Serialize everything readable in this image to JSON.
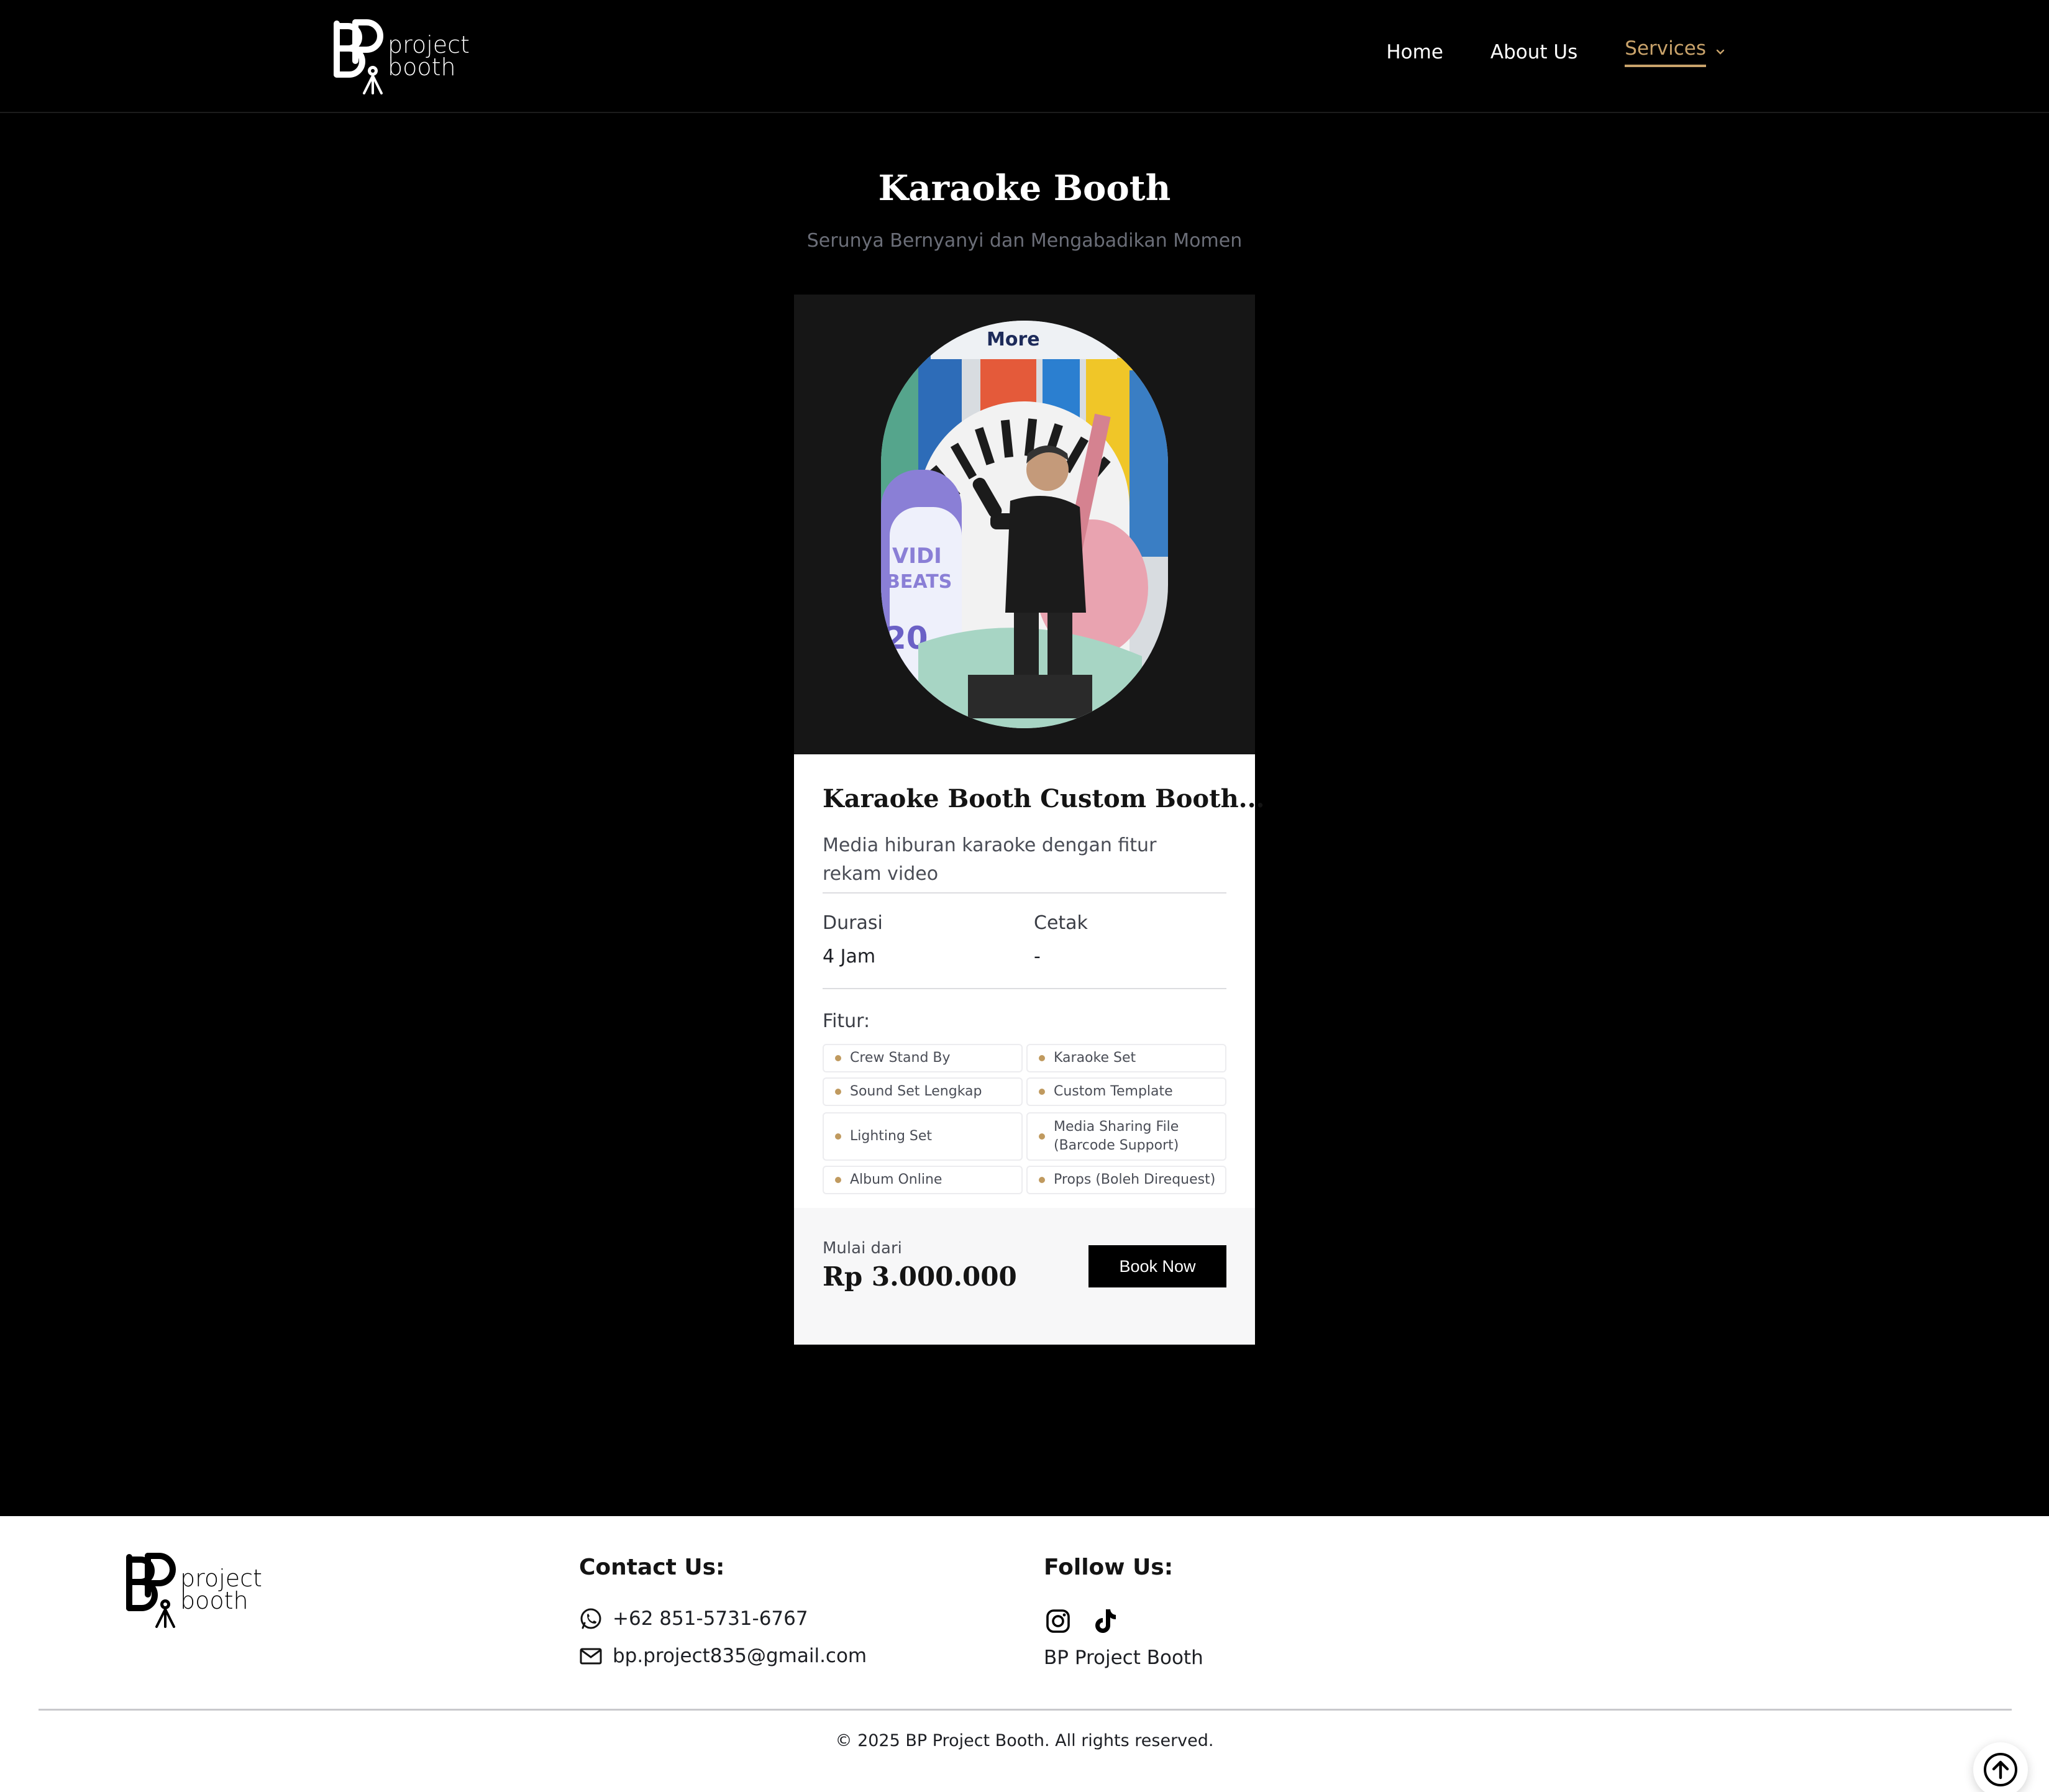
{
  "header": {
    "logo_line1": "project",
    "logo_line2": "booth",
    "nav": {
      "home": "Home",
      "about": "About Us",
      "services": "Services"
    }
  },
  "hero": {
    "title": "Karaoke Booth",
    "subtitle": "Serunya Bernyanyi dan Mengabadikan Momen"
  },
  "card": {
    "image_alt": "Karaoke singer performing at booth",
    "title": "Karaoke Booth Custom Booth...",
    "description": "Media hiburan karaoke dengan fitur rekam video",
    "duration_label": "Durasi",
    "duration_value": "4 Jam",
    "print_label": "Cetak",
    "print_value": "-",
    "features_label": "Fitur:",
    "features": [
      "Crew Stand By",
      "Karaoke Set",
      "Sound Set Lengkap",
      "Custom Template",
      "Lighting Set",
      "Media Sharing File (Barcode Support)",
      "Album Online",
      "Props (Boleh Direquest)"
    ],
    "price_label": "Mulai dari",
    "price": "Rp 3.000.000",
    "book_button": "Book Now"
  },
  "footer": {
    "logo_line1": "project",
    "logo_line2": "booth",
    "contact_heading": "Contact Us:",
    "phone": "+62 851-5731-6767",
    "email": "bp.project835@gmail.com",
    "follow_heading": "Follow Us:",
    "brand": "BP Project Booth",
    "copyright": "© 2025 BP Project Booth. All rights reserved."
  },
  "colors": {
    "accent": "#c9a36b",
    "background": "#000000",
    "card": "#ffffff"
  }
}
